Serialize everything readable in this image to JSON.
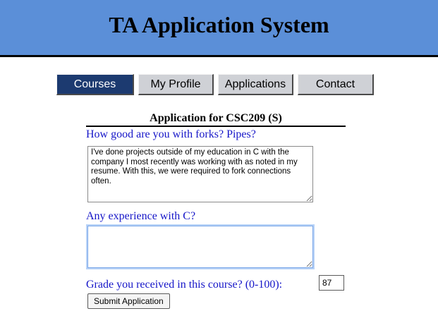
{
  "header": {
    "title": "TA Application System"
  },
  "nav": {
    "items": [
      {
        "label": "Courses",
        "active": true
      },
      {
        "label": "My Profile",
        "active": false
      },
      {
        "label": "Applications",
        "active": false
      },
      {
        "label": "Contact",
        "active": false
      }
    ]
  },
  "form": {
    "title": "Application for CSC209 (S)",
    "questions": [
      {
        "label": "How good are you with forks? Pipes?",
        "answer": "I've done projects outside of my education in C with the company I most recently was working with as noted in my resume. With this, we were required to fork connections often."
      },
      {
        "label": "Any experience with C?",
        "answer": ""
      }
    ],
    "grade": {
      "label": "Grade you received in this course? (0-100):",
      "value": "87"
    },
    "submit_label": "Submit Application"
  },
  "colors": {
    "header_bg": "#5b8fd8",
    "nav_active_bg": "#1c3a70",
    "question_text": "#1515c8"
  }
}
